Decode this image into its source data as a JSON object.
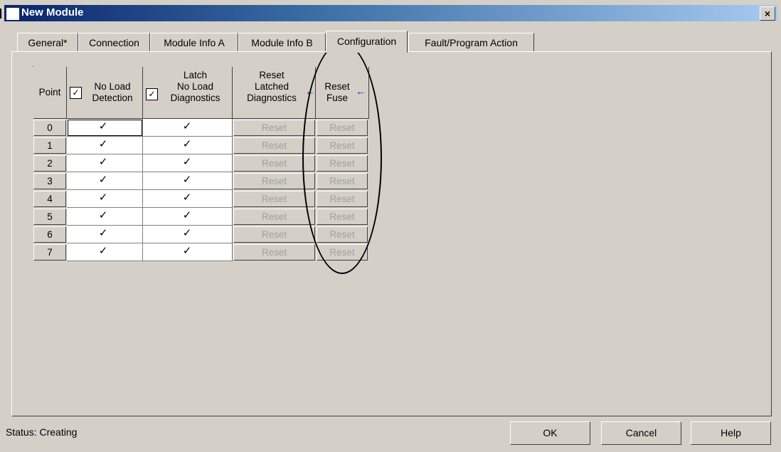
{
  "window": {
    "title": "New Module",
    "close_glyph": "×"
  },
  "tabs": [
    {
      "label": "General*"
    },
    {
      "label": "Connection"
    },
    {
      "label": "Module Info A"
    },
    {
      "label": "Module Info B"
    },
    {
      "label": "Configuration",
      "active": true
    },
    {
      "label": "Fault/Program Action"
    }
  ],
  "table": {
    "headers": {
      "point": "Point",
      "no_load_line1": "No Load",
      "no_load_line2": "Detection",
      "latch_line1": "Latch",
      "latch_line2": "No Load",
      "latch_line3": "Diagnostics",
      "reset_latched_line1": "Reset",
      "reset_latched_line2": "Latched",
      "reset_latched_line3": "Diagnostics",
      "reset_fuse_line1": "Reset",
      "reset_fuse_line2": "Fuse",
      "header_check_glyph": "✓",
      "arrow_glyph": "←"
    },
    "rows": [
      {
        "point": "0",
        "no_load": "✓",
        "latch": "✓",
        "reset_latched": "Reset",
        "reset_fuse": "Reset"
      },
      {
        "point": "1",
        "no_load": "✓",
        "latch": "✓",
        "reset_latched": "Reset",
        "reset_fuse": "Reset"
      },
      {
        "point": "2",
        "no_load": "✓",
        "latch": "✓",
        "reset_latched": "Reset",
        "reset_fuse": "Reset"
      },
      {
        "point": "3",
        "no_load": "✓",
        "latch": "✓",
        "reset_latched": "Reset",
        "reset_fuse": "Reset"
      },
      {
        "point": "4",
        "no_load": "✓",
        "latch": "✓",
        "reset_latched": "Reset",
        "reset_fuse": "Reset"
      },
      {
        "point": "5",
        "no_load": "✓",
        "latch": "✓",
        "reset_latched": "Reset",
        "reset_fuse": "Reset"
      },
      {
        "point": "6",
        "no_load": "✓",
        "latch": "✓",
        "reset_latched": "Reset",
        "reset_fuse": "Reset"
      },
      {
        "point": "7",
        "no_load": "✓",
        "latch": "✓",
        "reset_latched": "Reset",
        "reset_fuse": "Reset"
      }
    ]
  },
  "status": {
    "text": "Status:  Creating"
  },
  "buttons": {
    "ok": "OK",
    "cancel": "Cancel",
    "help": "Help"
  },
  "colors": {
    "titlebar_start": "#0a246a",
    "titlebar_end": "#a6caf0",
    "dialog_bg": "#d4d0c8",
    "disabled_text": "#a0a0a0",
    "arrow": "#1a1aa8"
  }
}
